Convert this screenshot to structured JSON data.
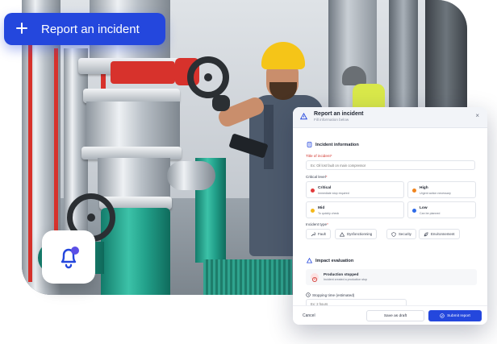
{
  "cta": {
    "label": "Report an incident",
    "icon": "plus-icon"
  },
  "colors": {
    "accent": "#2447dd",
    "critical": "#e23b3b",
    "high": "#f0851f",
    "mid": "#f4b81b",
    "low": "#2f6be8",
    "danger": "#d0342c"
  },
  "modal": {
    "title": "Report an incident",
    "subtitle": "Fill information below",
    "close_glyph": "×",
    "incident_section": {
      "title": "Incident information",
      "title_label": "Title of incident",
      "title_required": "*",
      "title_placeholder": "Ex: Oil lost fault on main compressor",
      "criticity_label": "Critical level",
      "criticity_required": "*",
      "levels": [
        {
          "name": "Critical",
          "desc": "Immediate stop required"
        },
        {
          "name": "High",
          "desc": "Urgent action necessary"
        },
        {
          "name": "Mid",
          "desc": "To quickly check"
        },
        {
          "name": "Low",
          "desc": "Can be planned"
        }
      ],
      "type_label": "Incident type",
      "type_required": "*",
      "types": [
        "Fault",
        "Dysfonctionning",
        "Security",
        "Environnement"
      ]
    },
    "impact_section": {
      "title": "Impact evaluation",
      "impact_title": "Production stopped",
      "impact_desc": "Incident created a production stop",
      "stop_label": "Stopping time (estimated)",
      "stop_placeholder": "Ex: 2 hours"
    },
    "footer": {
      "cancel": "Cancel",
      "draft": "Save as draft",
      "submit": "Submit report"
    }
  }
}
